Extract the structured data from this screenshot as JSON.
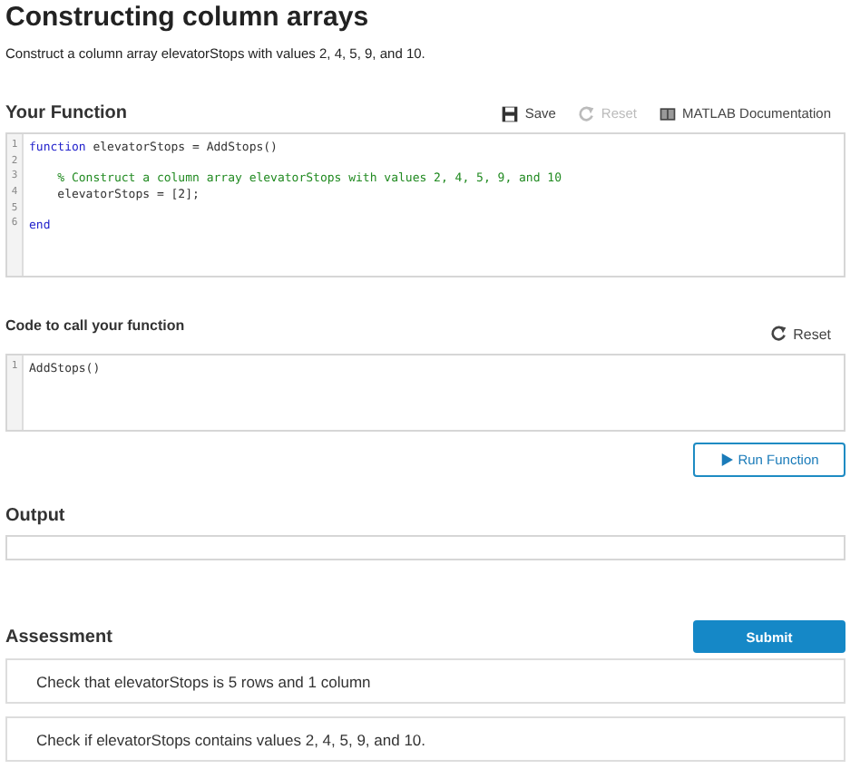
{
  "title": "Constructing column arrays",
  "description": "Construct a column array elevatorStops with values 2, 4, 5, 9, and 10.",
  "function_section": {
    "heading": "Your Function",
    "toolbar": [
      {
        "label": "Save",
        "kind": "save",
        "disabled": false
      },
      {
        "label": "Reset",
        "kind": "reset",
        "disabled": true
      },
      {
        "label": "MATLAB Documentation",
        "kind": "docs",
        "disabled": false
      }
    ],
    "code_lines": [
      {
        "number": "1",
        "tokens": [
          {
            "kind": "keyword",
            "text": "function"
          },
          {
            "kind": "plain",
            "text": " elevatorStops = AddStops()"
          }
        ]
      },
      {
        "number": "2"
      },
      {
        "number": "3",
        "tokens": [
          {
            "kind": "comment",
            "text": "    % Construct a column array elevatorStops with values 2, 4, 5, 9, and 10"
          }
        ]
      },
      {
        "number": "4",
        "tokens": [
          {
            "kind": "plain",
            "text": "    elevatorStops = [2];"
          }
        ]
      },
      {
        "number": "5"
      },
      {
        "number": "6",
        "tokens": [
          {
            "kind": "keyword",
            "text": "end"
          }
        ]
      }
    ]
  },
  "call_section": {
    "heading": "Code to call your function",
    "reset": {
      "label": "Reset",
      "disabled": false
    },
    "code_lines": [
      {
        "number": "1",
        "tokens": [
          {
            "kind": "plain",
            "text": "AddStops()"
          }
        ]
      }
    ]
  },
  "run_button": "Run Function",
  "output": {
    "heading": "Output"
  },
  "assessment": {
    "heading": "Assessment",
    "submit": "Submit",
    "checks": [
      "Check that elevatorStops is 5 rows and 1 column",
      "Check if elevatorStops contains values 2, 4, 5, 9, and 10."
    ]
  }
}
